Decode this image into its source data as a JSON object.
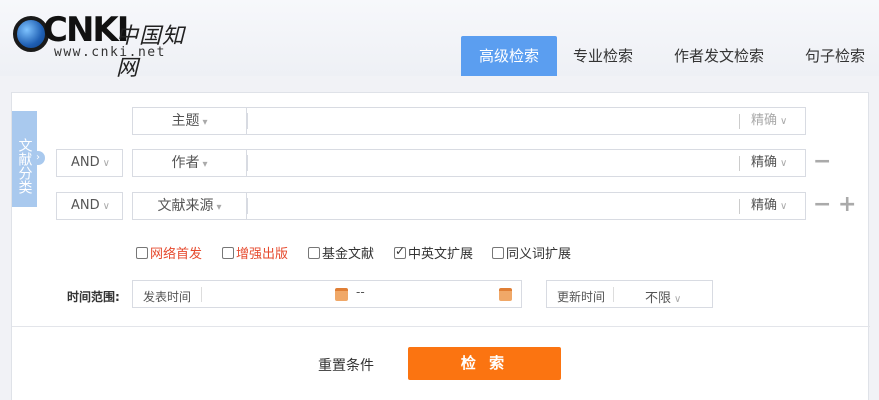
{
  "logo": {
    "brand": "CNKI",
    "chinese_name": "中国知网",
    "url": "www.cnki.net"
  },
  "tabs": [
    {
      "label": "高级检索",
      "active": true
    },
    {
      "label": "专业检索",
      "active": false
    },
    {
      "label": "作者发文检索",
      "active": false
    },
    {
      "label": "句子检索",
      "active": false
    }
  ],
  "side_tab": {
    "label": "文献分类"
  },
  "rows": [
    {
      "logic": "",
      "field": "主题",
      "exact": "精确"
    },
    {
      "logic": "AND",
      "field": "作者",
      "exact": "精确"
    },
    {
      "logic": "AND",
      "field": "文献来源",
      "exact": "精确"
    }
  ],
  "options": [
    {
      "label": "网络首发",
      "checked": false
    },
    {
      "label": "增强出版",
      "checked": false
    },
    {
      "label": "基金文献",
      "checked": false
    },
    {
      "label": "中英文扩展",
      "checked": true
    },
    {
      "label": "同义词扩展",
      "checked": false
    }
  ],
  "time": {
    "label": "时间范围:",
    "publish_label": "发表时间",
    "separator": "--",
    "update_label": "更新时间",
    "update_value": "不限"
  },
  "actions": {
    "reset": "重置条件",
    "search": "检 索"
  },
  "colors": {
    "accent": "#5b9ef0",
    "search_button": "#fb7411",
    "highlight_text": "#e64a2e"
  },
  "icons": {
    "caret": "chevron-down-icon",
    "calendar": "calendar-icon",
    "minus": "minus-icon",
    "plus": "plus-icon"
  }
}
